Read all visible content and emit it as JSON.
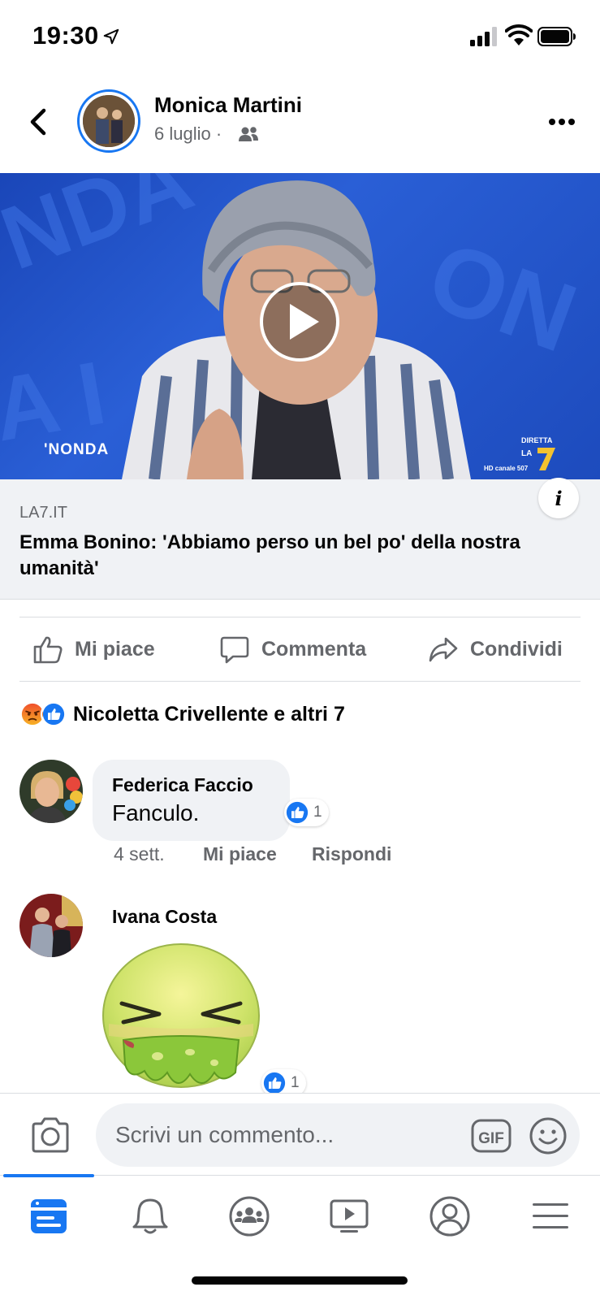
{
  "status_bar": {
    "time": "19:30",
    "icons": [
      "location-arrow-icon",
      "signal-icon",
      "wifi-icon",
      "battery-icon"
    ]
  },
  "post": {
    "author": "Monica Martini",
    "date": "6 luglio · ",
    "audience_icon": "friends-icon"
  },
  "video": {
    "overlay_left": "'NONDA",
    "channel_badge": [
      "DIRETTA",
      "LA",
      "HD canale 507"
    ],
    "play_icon": "play-icon"
  },
  "link": {
    "domain": "LA7.IT",
    "title": "Emma Bonino: 'Abbiamo perso un bel po' della nostra umanità'",
    "info_label": "i"
  },
  "actions": {
    "like": "Mi piace",
    "comment": "Commenta",
    "share": "Condividi"
  },
  "reactions": {
    "icons": [
      "angry-icon",
      "like-icon"
    ],
    "summary": "Nicoletta Crivellente e altri 7"
  },
  "comments": [
    {
      "author": "Federica Faccio",
      "text": "Fanculo.",
      "likes": "1",
      "time": "4 sett.",
      "like_label": "Mi piace",
      "reply_label": "Rispondi"
    },
    {
      "author": "Ivana Costa",
      "sticker": "nauseated-sticker",
      "likes": "1"
    }
  ],
  "composer": {
    "placeholder": "Scrivi un commento...",
    "gif_label": "GIF"
  },
  "tabbar": {
    "tabs": [
      "news-feed-icon",
      "bell-icon",
      "groups-icon",
      "watch-icon",
      "profile-icon",
      "menu-icon"
    ],
    "active": "news-feed-icon"
  },
  "colors": {
    "accent": "#1877f2",
    "secondary_text": "#65676b",
    "bubble": "#f0f2f5"
  }
}
